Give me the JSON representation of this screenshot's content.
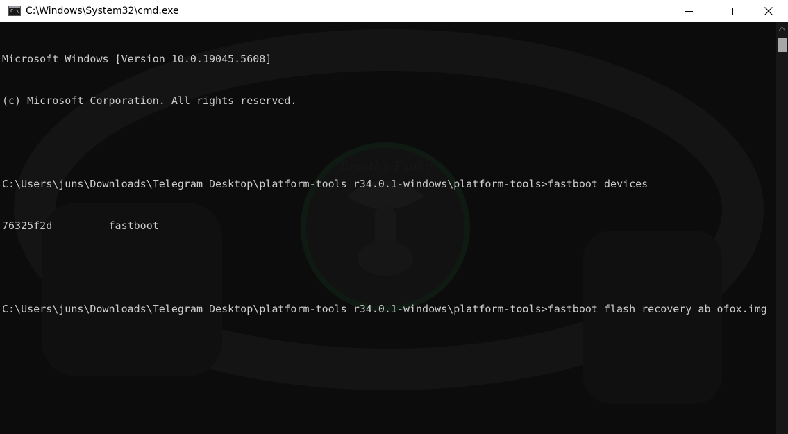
{
  "window": {
    "title": "C:\\Windows\\System32\\cmd.exe",
    "app_icon_text": "C:\\.",
    "controls": [
      "minimize-icon",
      "maximize-icon",
      "close-icon"
    ]
  },
  "console": {
    "lines": [
      "Microsoft Windows [Version 10.0.19045.5608]",
      "(c) Microsoft Corporation. All rights reserved.",
      "",
      "C:\\Users\\juns\\Downloads\\Telegram Desktop\\platform-tools_r34.0.1-windows\\platform-tools>fastboot devices",
      "76325f2d         fastboot",
      "",
      "C:\\Users\\juns\\Downloads\\Telegram Desktop\\platform-tools_r34.0.1-windows\\platform-tools>fastboot flash recovery_ab ofox.img"
    ],
    "watermark_text": "Tonathy Tunky"
  },
  "colors": {
    "console_bg": "#0c0c0c",
    "console_text": "#cccccc",
    "titlebar_bg": "#ffffff"
  }
}
